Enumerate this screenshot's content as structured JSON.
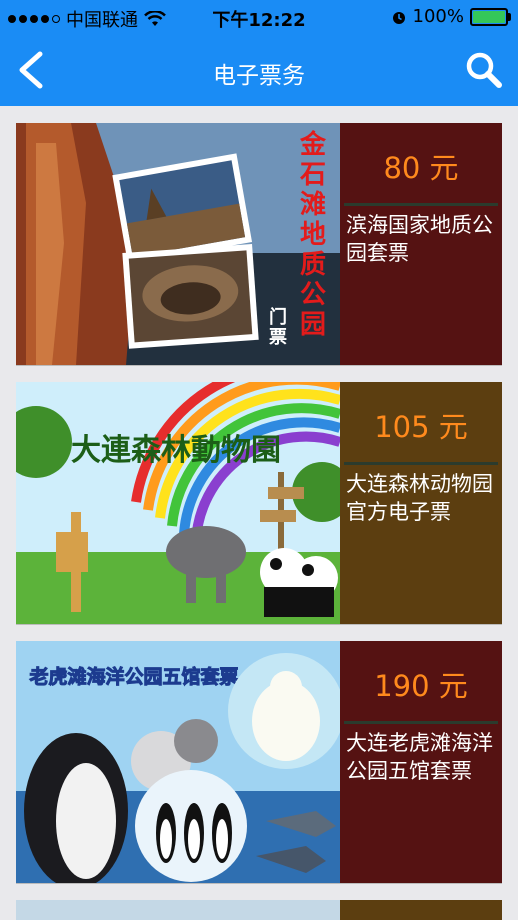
{
  "status": {
    "carrier": "中国联通",
    "time": "下午12:22",
    "battery": "100%"
  },
  "nav": {
    "title": "电子票务"
  },
  "tickets": [
    {
      "price": "80 元",
      "name": "滨海国家地质公园套票",
      "image_title": "金石滩地质公园",
      "image_subtitle": "门票",
      "info_color": "#551212"
    },
    {
      "price": "105 元",
      "name": "大连森林动物园官方电子票",
      "image_title": "大連森林動物園",
      "info_color": "#5c3e10"
    },
    {
      "price": "190 元",
      "name": "大连老虎滩海洋公园五馆套票",
      "image_title": "老虎滩海洋公园五馆套票",
      "info_color": "#551212"
    }
  ]
}
